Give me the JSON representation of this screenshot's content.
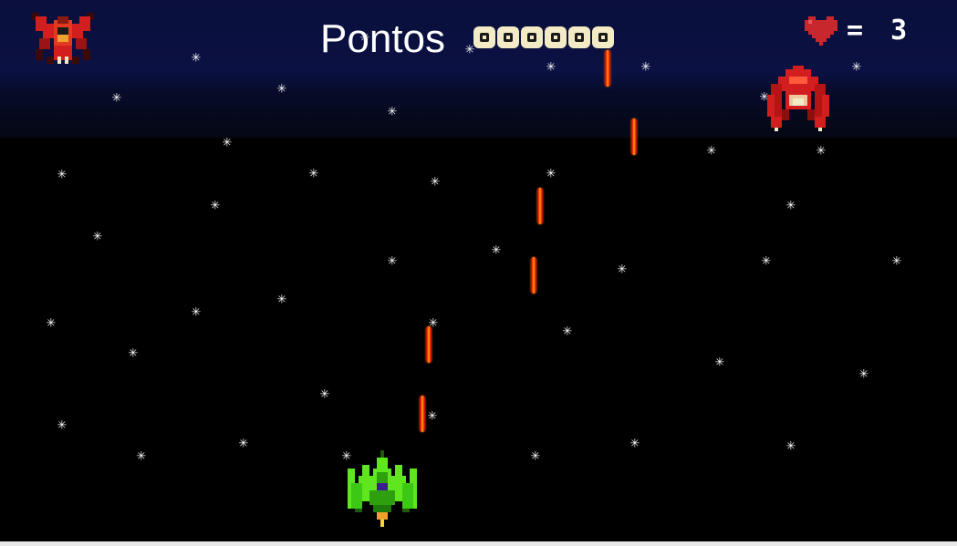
{
  "hud": {
    "score_label": "Pontos",
    "score_digits": [
      "0",
      "0",
      "0",
      "0",
      "0",
      "0"
    ],
    "lives_text": "= 3",
    "lives_icon": "heart-icon",
    "lives_count": 3
  },
  "colors": {
    "background": "#000000",
    "hud_band": "#0b1142",
    "star": "#ffffff",
    "laser": "#ff3a00",
    "player_ship": "#5fe61e",
    "enemy": "#d21e1e",
    "score_digit_bg": "#f3ebc6",
    "heart": "#c8282d"
  },
  "sprites": {
    "player": "green-fighter-ship-icon",
    "enemy_active": "red-crab-alien-icon",
    "enemy_hud": "red-winged-alien-icon"
  }
}
